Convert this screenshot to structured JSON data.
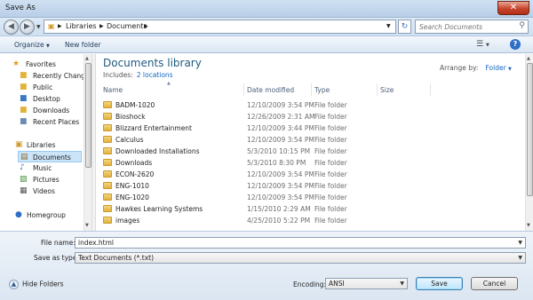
{
  "window": {
    "title": "Save As",
    "close_glyph": "✕"
  },
  "address": {
    "crumbs": [
      "Libraries",
      "Documents"
    ],
    "search_placeholder": "Search Documents"
  },
  "toolbar": {
    "organize": "Organize",
    "new_folder": "New folder"
  },
  "nav": {
    "favorites": "Favorites",
    "favorites_items": [
      "Recently Changed",
      "Public",
      "Desktop",
      "Downloads",
      "Recent Places"
    ],
    "libraries": "Libraries",
    "libraries_items": [
      "Documents",
      "Music",
      "Pictures",
      "Videos"
    ],
    "homegroup": "Homegroup"
  },
  "library": {
    "title": "Documents library",
    "includes_label": "Includes:",
    "includes_link": "2 locations",
    "arrange_label": "Arrange by:",
    "arrange_value": "Folder"
  },
  "columns": {
    "name": "Name",
    "date": "Date modified",
    "type": "Type",
    "size": "Size"
  },
  "files": [
    {
      "name": "BADM-1020",
      "date": "12/10/2009 3:54 PM",
      "type": "File folder"
    },
    {
      "name": "Bioshock",
      "date": "12/26/2009 2:31 AM",
      "type": "File folder"
    },
    {
      "name": "Blizzard Entertainment",
      "date": "12/10/2009 3:44 PM",
      "type": "File folder"
    },
    {
      "name": "Calculus",
      "date": "12/10/2009 3:54 PM",
      "type": "File folder"
    },
    {
      "name": "Downloaded Installations",
      "date": "5/3/2010 10:15 PM",
      "type": "File folder"
    },
    {
      "name": "Downloads",
      "date": "5/3/2010 8:30 PM",
      "type": "File folder"
    },
    {
      "name": "ECON-2620",
      "date": "12/10/2009 3:54 PM",
      "type": "File folder"
    },
    {
      "name": "ENG-1010",
      "date": "12/10/2009 3:54 PM",
      "type": "File folder"
    },
    {
      "name": "ENG-1020",
      "date": "12/10/2009 3:54 PM",
      "type": "File folder"
    },
    {
      "name": "Hawkes Learning Systems",
      "date": "1/15/2010 2:29 AM",
      "type": "File folder"
    },
    {
      "name": "images",
      "date": "4/25/2010 5:22 PM",
      "type": "File folder"
    }
  ],
  "form": {
    "filename_label": "File name:",
    "filename_value": "index.html",
    "savetype_label": "Save as type:",
    "savetype_value": "Text Documents (*.txt)",
    "encoding_label": "Encoding:",
    "encoding_value": "ANSI"
  },
  "buttons": {
    "hide_folders": "Hide Folders",
    "save": "Save",
    "cancel": "Cancel"
  },
  "colors": {
    "accent_link": "#1565c0",
    "library_title": "#1e5b7f",
    "selection": "#cce4f7"
  }
}
